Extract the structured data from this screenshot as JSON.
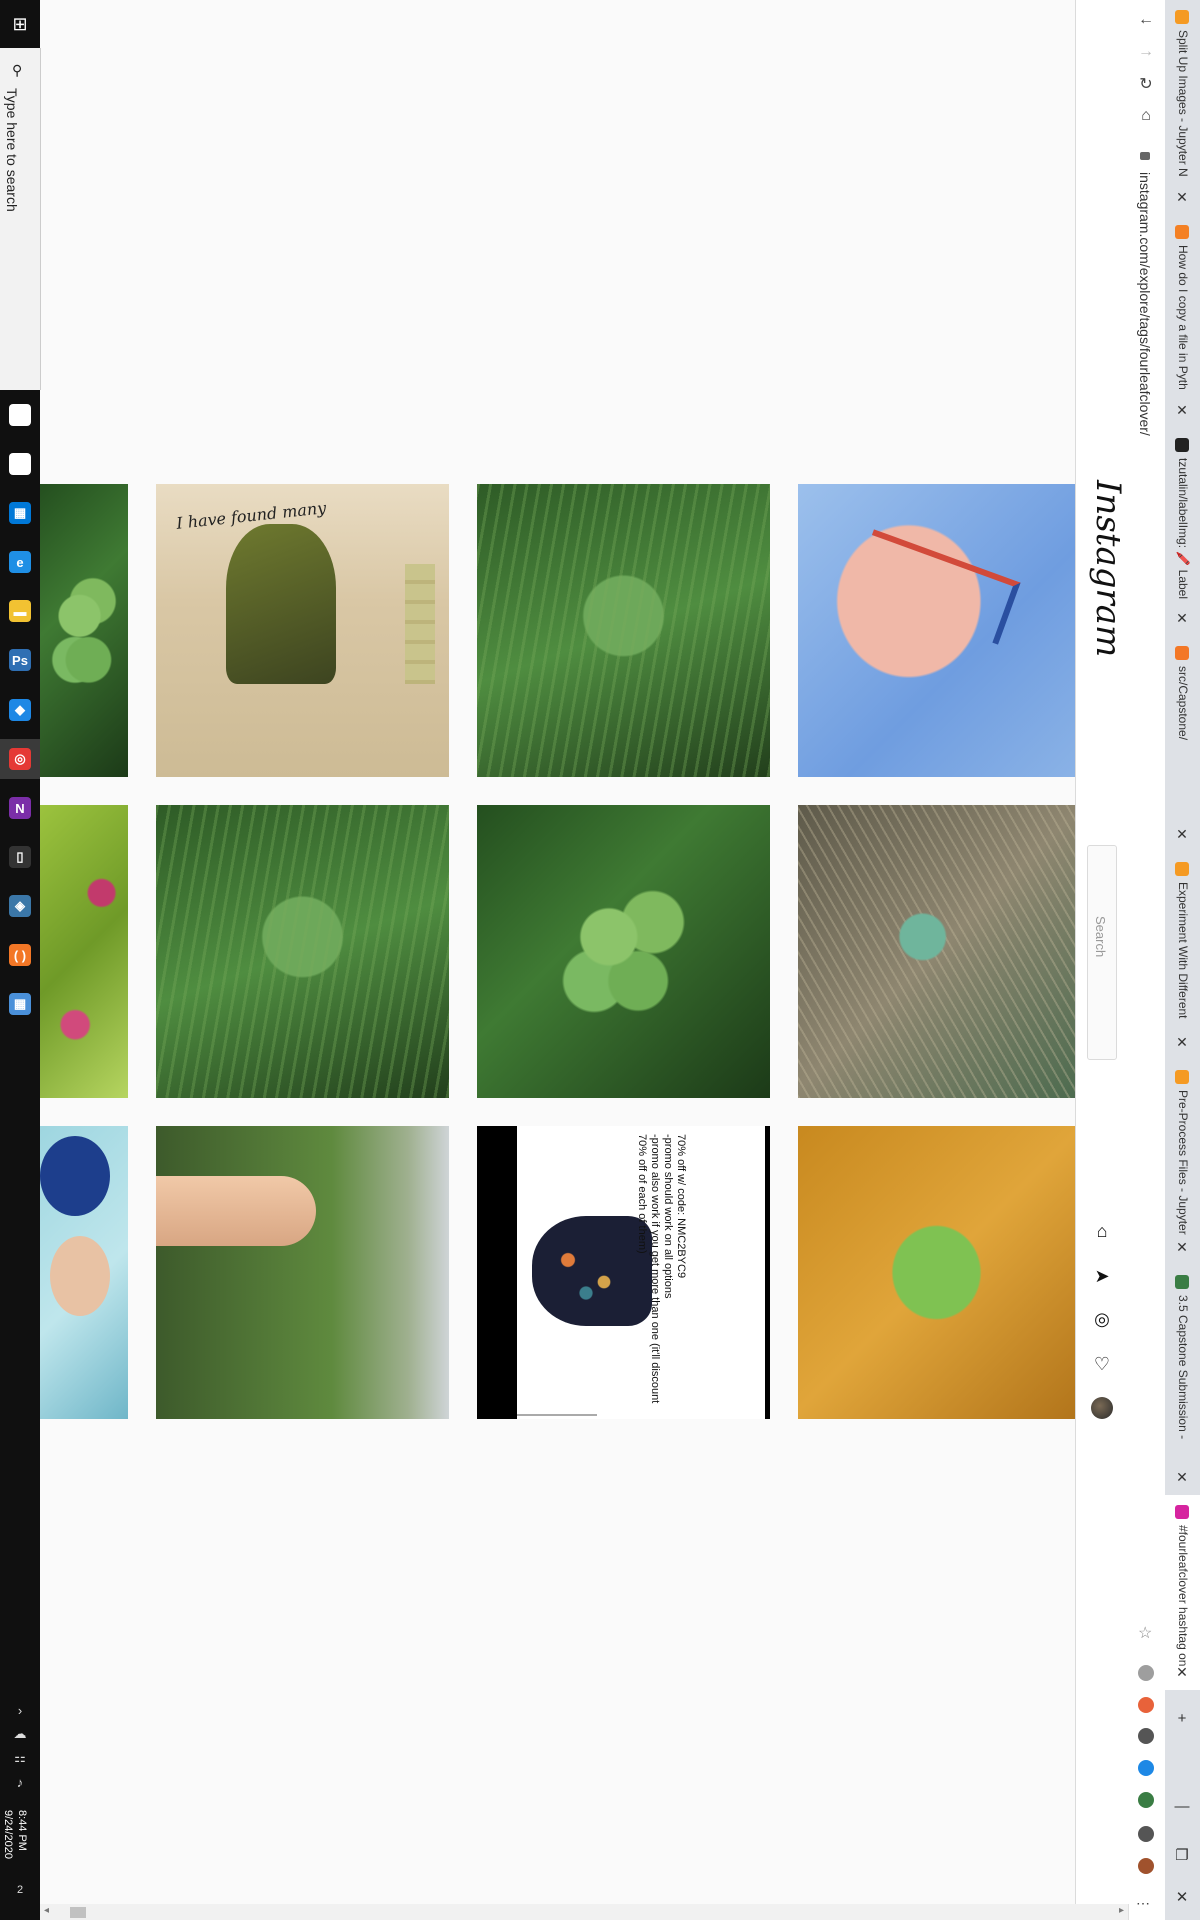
{
  "taskbar": {
    "search_placeholder": "Type here to search",
    "apps": [
      {
        "name": "cortana-icon",
        "glyph": "○",
        "color": "#ffffff"
      },
      {
        "name": "task-view-icon",
        "glyph": "⧉",
        "color": "#ffffff"
      },
      {
        "name": "microsoft-store-icon",
        "glyph": "▦",
        "color": "#0078d7"
      },
      {
        "name": "edge-icon",
        "glyph": "e",
        "color": "#1f8fe5"
      },
      {
        "name": "file-explorer-icon",
        "glyph": "▬",
        "color": "#f2c232"
      },
      {
        "name": "photoshop-icon",
        "glyph": "Ps",
        "color": "#2f6fb3"
      },
      {
        "name": "vscode-icon",
        "glyph": "◆",
        "color": "#1e88e5"
      },
      {
        "name": "chrome-icon",
        "glyph": "◎",
        "color": "#e53935"
      },
      {
        "name": "onenote-icon",
        "glyph": "N",
        "color": "#7b2ea8"
      },
      {
        "name": "terminal-icon",
        "glyph": "▯",
        "color": "#333333"
      },
      {
        "name": "python-icon",
        "glyph": "◈",
        "color": "#3b77a8"
      },
      {
        "name": "jupyter-icon",
        "glyph": "( )",
        "color": "#f37726"
      },
      {
        "name": "calculator-icon",
        "glyph": "▦",
        "color": "#4a90d9"
      }
    ],
    "time": "8:44 PM",
    "date": "9/24/2020",
    "notification_count": "2"
  },
  "browser": {
    "tabs": [
      {
        "title": "Split Up Images - Jupyter N",
        "favicon_color": "#f59a23"
      },
      {
        "title": "How do I copy a file in Pyth",
        "favicon_color": "#f48024"
      },
      {
        "title": "tzutalin/labelImg: 🖍️ Label",
        "favicon_color": "#222222"
      },
      {
        "title": "src/Capstone/",
        "favicon_color": "#f37726"
      },
      {
        "title": "Experiment With Different",
        "favicon_color": "#f59a23"
      },
      {
        "title": "Pre-Process Files - Jupyter",
        "favicon_color": "#f59a23"
      },
      {
        "title": "3.5 Capstone Submission -",
        "favicon_color": "#3a7d44"
      },
      {
        "title": "#fourleafclover hashtag on",
        "favicon_color": "#d6249f"
      }
    ],
    "url": "instagram.com/explore/tags/fourleafclover/",
    "nav": {
      "back": "←",
      "forward": "→",
      "reload": "↻",
      "home": "⌂"
    },
    "window": {
      "minimize": "—",
      "restore": "❐",
      "close": "✕",
      "new_tab": "+"
    },
    "extensions": [
      {
        "name": "bookmark-star-icon",
        "color": "#888888"
      },
      {
        "name": "grammarly-icon",
        "color": "#9e9e9e"
      },
      {
        "name": "adblock-icon",
        "color": "#e8623a"
      },
      {
        "name": "dark-mode-icon",
        "color": "#555555"
      },
      {
        "name": "extension-blue-icon",
        "color": "#1e88e5"
      },
      {
        "name": "extension-green-icon",
        "color": "#3a7d44"
      },
      {
        "name": "puzzle-icon",
        "color": "#555555"
      },
      {
        "name": "profile-icon",
        "color": "#a0522d"
      }
    ]
  },
  "instagram": {
    "logo": "Instagram",
    "search_placeholder": "Search",
    "nav_icons": [
      "home-icon",
      "direct-icon",
      "explore-icon",
      "activity-icon",
      "profile-avatar"
    ]
  },
  "posts": [
    {
      "name": "post-partial-clover-1",
      "kind": "clover"
    },
    {
      "name": "post-collage",
      "kind": "collage",
      "caption": "I have found many"
    },
    {
      "name": "post-clover-grass-1",
      "kind": "grass"
    },
    {
      "name": "post-tattoo",
      "kind": "tattoo"
    },
    {
      "name": "post-partial-pink",
      "kind": "pink"
    },
    {
      "name": "post-clover-grass-2",
      "kind": "grass"
    },
    {
      "name": "post-clover-grass-3",
      "kind": "clover"
    },
    {
      "name": "post-clover-dry",
      "kind": "dry"
    },
    {
      "name": "post-partial-person",
      "kind": "person"
    },
    {
      "name": "post-hand-grass",
      "kind": "hand"
    },
    {
      "name": "post-ad-dress",
      "kind": "ad",
      "lines": [
        "70% off w/ code: NMC2BYC9",
        "-promo should work on all options",
        "-promo also work if you get more than one (it'll discount",
        "70% off of each of them)"
      ]
    },
    {
      "name": "post-single-leaf",
      "kind": "leaf"
    }
  ]
}
